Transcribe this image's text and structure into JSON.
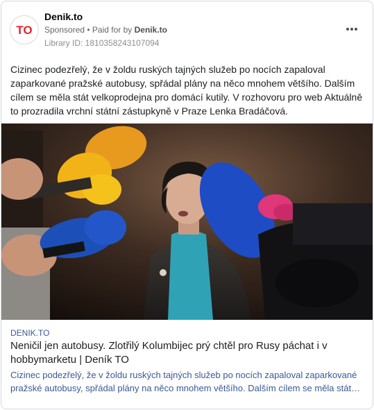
{
  "post": {
    "page_name": "Denik.to",
    "sponsored_label": "Sponsored",
    "separator": " • ",
    "paid_for_prefix": "Paid for by ",
    "paid_for_by": "Denik.to",
    "library_id": "Library ID: 1810358243107094",
    "logo_text": "TO",
    "body_text": "Cizinec podezřelý, že v žoldu ruských tajných služeb po nocích zapaloval zaparkované pražské autobusy, spřádal plány na něco mnohem většího. Dalším cílem se měla stát velkoprodejna pro domácí kutily. V rozhovoru pro web Aktuálně to prozradila vrchní státní zástupkyně v Praze Lenka Bradáčová."
  },
  "link_preview": {
    "domain": "DENIK.TO",
    "headline": "Neničil jen autobusy. Zlotřilý Kolumbijec prý chtěl pro Rusy páchat i v hobbymarketu | Deník TO",
    "description": "Cizinec podezřelý, že v žoldu ruských tajných služeb po nocích zapaloval zaparkované pražské autobusy, spřádal plány na něco mnohem většího. Dalším cílem se měla stát velkoprodejna pro domácí kutily."
  },
  "colors": {
    "brand_red": "#e0262d",
    "link_blue": "#385898",
    "meta_gray": "#65676b"
  },
  "icons": {
    "more": "more-options-icon",
    "logo": "denik-to-logo"
  }
}
